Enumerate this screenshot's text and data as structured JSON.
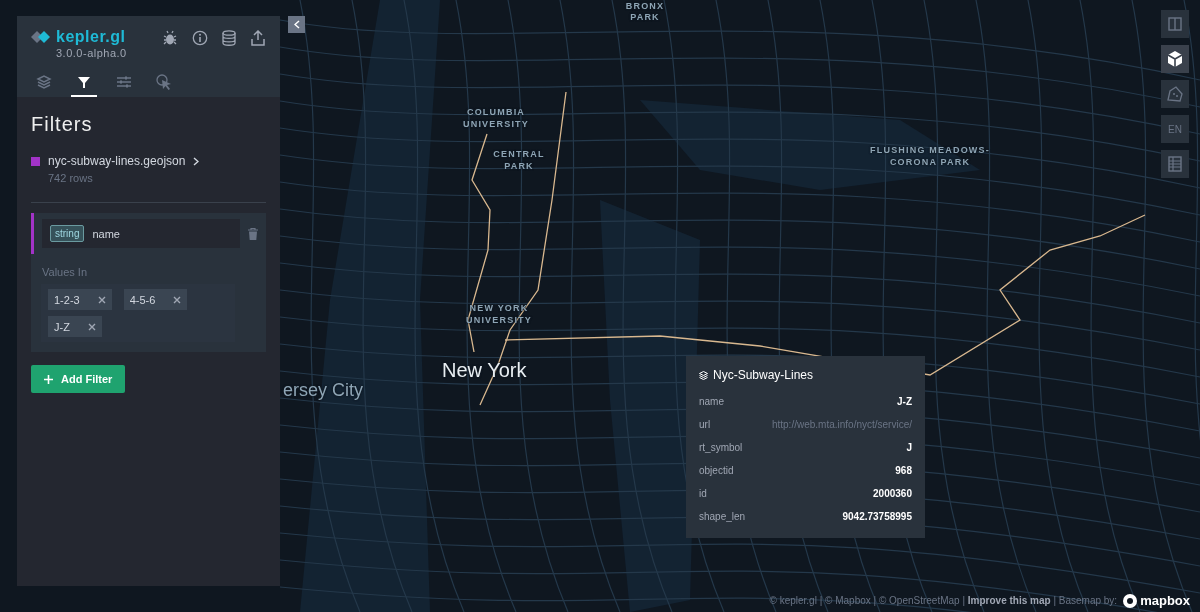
{
  "app": {
    "logo": "kepler.gl",
    "version": "3.0.0-alpha.0"
  },
  "nav_tabs": [
    {
      "kind": "layers",
      "selected": false
    },
    {
      "kind": "filters",
      "selected": true
    },
    {
      "kind": "settings",
      "selected": false
    },
    {
      "kind": "interactions",
      "selected": false
    }
  ],
  "panel": {
    "title": "Filters",
    "dataset": {
      "name": "nyc-subway-lines.geojson",
      "rows": "742 rows",
      "color": "#a233c7"
    },
    "filter": {
      "type_tag": "string",
      "field": "name",
      "values_label": "Values In",
      "values": [
        "1-2-3",
        "4-5-6",
        "J-Z"
      ]
    },
    "add_filter": "Add Filter"
  },
  "map": {
    "labels": [
      {
        "text": "BRONX",
        "kind": "poi"
      },
      {
        "text": "PARK",
        "kind": "poi"
      },
      {
        "text": "COLUMBIA UNIVERSITY",
        "kind": "poi"
      },
      {
        "text": "CENTRAL PARK",
        "kind": "poi"
      },
      {
        "text": "FLUSHING MEADOWS-CORONA PARK",
        "kind": "poi"
      },
      {
        "text": "NEW YORK UNIVERSITY",
        "kind": "poi"
      },
      {
        "text": "New York",
        "kind": "city"
      },
      {
        "text": "ersey City",
        "kind": "town"
      }
    ]
  },
  "map_controls": [
    {
      "kind": "split",
      "selected": false
    },
    {
      "kind": "cube",
      "selected": true
    },
    {
      "kind": "draw",
      "selected": false
    },
    {
      "kind": "locale",
      "label": "EN",
      "selected": false
    },
    {
      "kind": "legend",
      "selected": false
    }
  ],
  "tooltip": {
    "title": "Nyc-Subway-Lines",
    "rows": [
      {
        "field": "name",
        "value": "J-Z",
        "dimmed": false
      },
      {
        "field": "url",
        "value": "http://web.mta.info/nyct/service/",
        "dimmed": true
      },
      {
        "field": "rt_symbol",
        "value": "J",
        "dimmed": false
      },
      {
        "field": "objectid",
        "value": "968",
        "dimmed": false
      },
      {
        "field": "id",
        "value": "2000360",
        "dimmed": false
      },
      {
        "field": "shape_len",
        "value": "9042.73758995",
        "dimmed": false
      }
    ]
  },
  "attribution": {
    "text": "© kepler.gl | © Mapbox | © OpenStreetMap | **Improve this map** | Basemap by:",
    "logo": "mapbox"
  }
}
